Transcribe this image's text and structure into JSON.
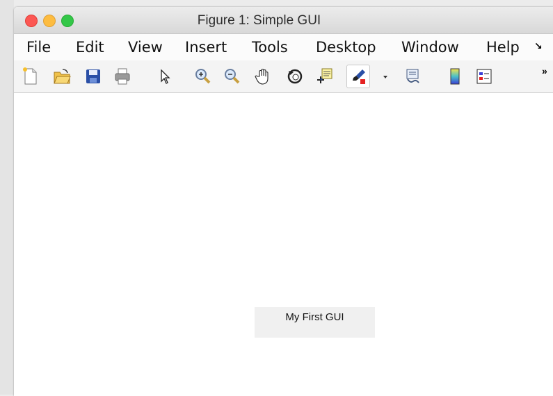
{
  "window": {
    "title": "Figure 1: Simple GUI"
  },
  "menu": [
    "File",
    "Edit",
    "View",
    "Insert",
    "Tools",
    "Desktop",
    "Window",
    "Help"
  ],
  "menu_overflow": "↘",
  "toolbar": {
    "overflow": "»",
    "icons": [
      "new-figure-icon",
      "open-file-icon",
      "save-icon",
      "print-icon",
      "pointer-arrow-icon",
      "zoom-in-icon",
      "zoom-out-icon",
      "pan-hand-icon",
      "rotate-3d-icon",
      "data-cursor-icon",
      "brush-icon",
      "brush-dropdown-icon",
      "link-plot-icon",
      "colorbar-icon",
      "legend-icon"
    ]
  },
  "content": {
    "label": "My First GUI"
  },
  "colors": {
    "close": "#fc5753",
    "minimize": "#fdbc40",
    "zoom": "#33c748",
    "label_bg": "#f0f0f0"
  }
}
